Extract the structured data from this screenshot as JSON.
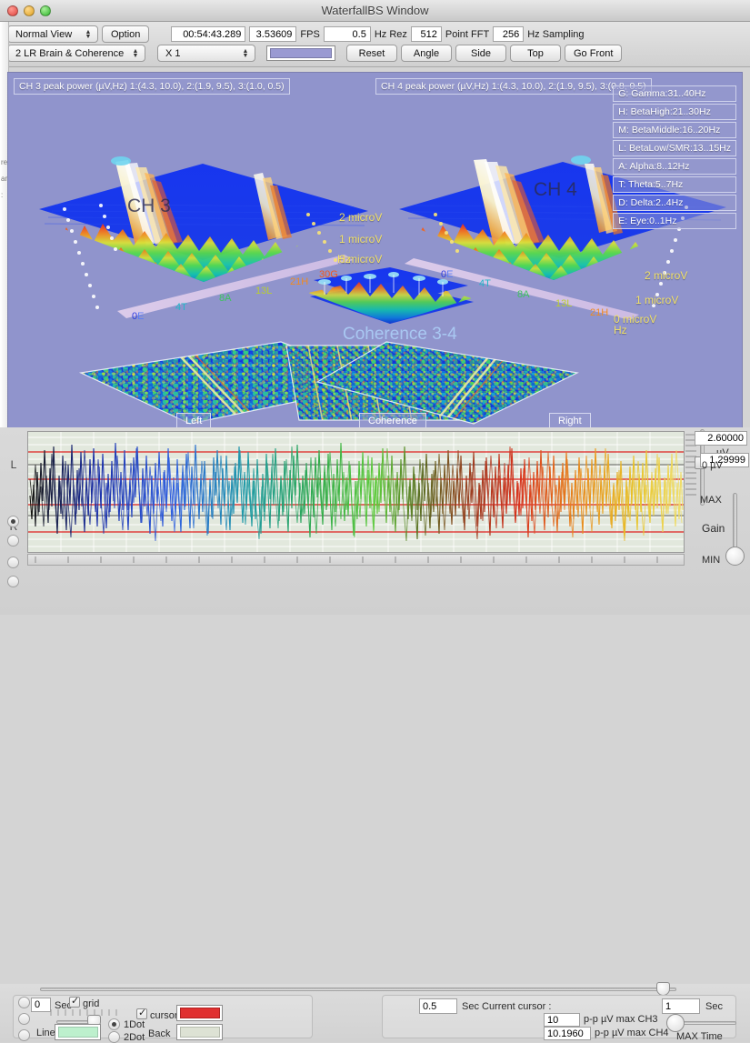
{
  "window": {
    "title": "WaterfallBS Window",
    "traffic_lights": [
      "close",
      "minimize",
      "zoom"
    ]
  },
  "toolbar": {
    "view_mode": "Normal View",
    "option_button": "Option",
    "time_value": "00:54:43.289",
    "fps_value": "3.53609",
    "fps_label": "FPS",
    "hz_rez_value": "0.5",
    "hz_rez_label": "Hz Rez",
    "point_fft_value": "512",
    "point_fft_label": "Point FFT",
    "hz_sampling_value": "256",
    "hz_sampling_label": "Hz Sampling",
    "channel_mode": "2 LR Brain & Coherence",
    "zoom_factor": "X 1",
    "color_swatch": "#9a9ad2",
    "reset_button": "Reset",
    "angle_button": "Angle",
    "side_button": "Side",
    "top_button": "Top",
    "go_front_button": "Go Front"
  },
  "view3d": {
    "background_color": "#9094cc",
    "ch3_peak": "CH 3 peak power (µV,Hz) 1:(4.3, 10.0), 2:(1.9, 9.5), 3:(1.0, 0.5)",
    "ch4_peak": "CH 4 peak power (µV,Hz) 1:(4.3, 10.0), 2:(1.9, 9.5), 3:(0.8, 0.5)",
    "ch3_label": "CH 3",
    "ch4_label": "CH 4",
    "coherence_label": "Coherence 3-4",
    "amp_axis_left": [
      "2 microV",
      "1 microV",
      "0 microV"
    ],
    "amp_axis_right": [
      "2 microV",
      "1 microV",
      "0 microV"
    ],
    "hz_label": "Hz",
    "hz_ticks": [
      {
        "text": "0",
        "band": "E"
      },
      {
        "text": "4",
        "band": "T"
      },
      {
        "text": "8",
        "band": "A"
      },
      {
        "text": "13",
        "band": "L"
      },
      {
        "text": "21",
        "band": "H"
      },
      {
        "text": "30",
        "band": "G"
      }
    ],
    "band_legend": [
      "G: Gamma:31..40Hz",
      "H: BetaHigh:21..30Hz",
      "M: BetaMiddle:16..20Hz",
      "L: BetaLow/SMR:13..15Hz",
      "A: Alpha:8..12Hz",
      "T: Theta:5..7Hz",
      "D: Delta:2..4Hz",
      "E: Eye:0..1Hz"
    ],
    "buttons": {
      "left": "Left",
      "coherence": "Coherence",
      "right": "Right"
    }
  },
  "signal": {
    "channel_labels": [
      "L",
      "R"
    ],
    "scale_top": "2.60000",
    "scale_top_unit": "µV",
    "scale_mid": "1.29999",
    "scale_zero": "0 µV",
    "gain": {
      "max_label": "MAX",
      "title": "Gain",
      "min_label": "MIN"
    }
  },
  "bottom": {
    "sec_value": "0",
    "sec_label": "Sec",
    "grid_label": "grid",
    "grid_checked": true,
    "line_label": "Line",
    "line_color": "#bdf0cd",
    "dot_options": [
      "1Dot",
      "2Dot"
    ],
    "dot_selected": "1Dot",
    "cursor_label": "cursor",
    "cursor_checked": true,
    "cursor_color": "#e03030",
    "back_label": "Back",
    "back_color": "#dde2d4",
    "current_cursor_value": "0.5",
    "current_cursor_label": "Sec Current cursor :",
    "sec_right_value": "1",
    "sec_right_label": "Sec",
    "pp_ch3_value": "10",
    "pp_ch3_label": "p-p µV max CH3",
    "pp_ch4_value": "10.1960",
    "pp_ch4_label": "p-p µV max CH4",
    "max_time_label": "MAX Time"
  }
}
